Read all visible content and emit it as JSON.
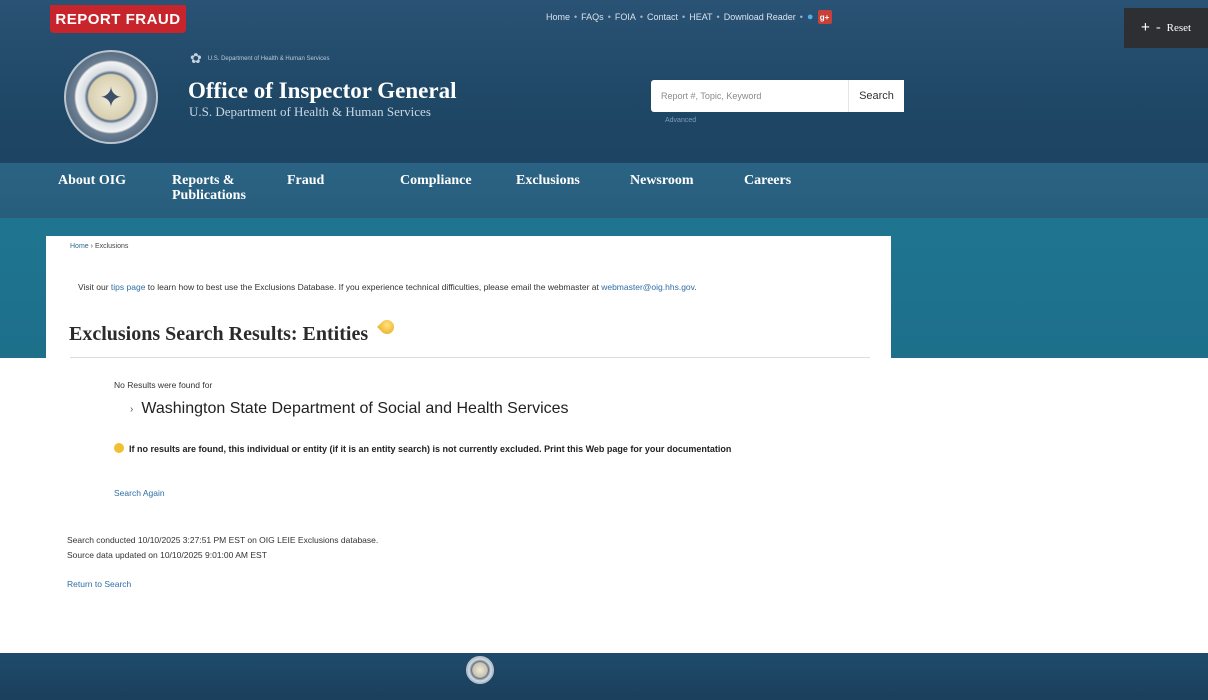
{
  "header": {
    "report_fraud": "REPORT FRAUD",
    "utility_links": [
      "Home",
      "FAQs",
      "FOIA",
      "Contact",
      "HEAT",
      "Download Reader"
    ],
    "separator": "•",
    "dept_line": "U.S. Department of Health & Human Services",
    "title": "Office of Inspector General",
    "subtitle": "U.S. Department of Health & Human Services",
    "search_placeholder": "Report #, Topic, Keyword",
    "search_button": "Search",
    "advanced": "Advanced",
    "reset_label": "Reset",
    "plus": "+",
    "minus": "-"
  },
  "nav": [
    {
      "label": "About OIG"
    },
    {
      "label": "Reports & Publications"
    },
    {
      "label": "Fraud"
    },
    {
      "label": "Compliance"
    },
    {
      "label": "Exclusions"
    },
    {
      "label": "Newsroom"
    },
    {
      "label": "Careers"
    }
  ],
  "breadcrumb": {
    "home": "Home",
    "sep": "›",
    "current": "Exclusions"
  },
  "intro": {
    "pre": "Visit our ",
    "tips_link": "tips page",
    "mid": " to learn how to best use the Exclusions Database. If you experience technical difficulties, please email the webmaster at ",
    "email_link": "webmaster@oig.hhs.gov",
    "post": "."
  },
  "page_title": "Exclusions Search Results: Entities",
  "results": {
    "no_results": "No Results were found for",
    "entity": "Washington State Department of Social and Health Services",
    "notice": "If no results are found, this individual or entity (if it is an entity search) is not currently excluded. Print this Web page for your documentation",
    "search_again": "Search Again",
    "conducted": "Search conducted 10/10/2025 3:27:51 PM EST on OIG LEIE Exclusions database.",
    "updated": "Source data updated on 10/10/2025 9:01:00 AM EST",
    "return": "Return to Search"
  },
  "icons": {
    "arrow": "›",
    "twitter": "twitter-icon",
    "googleplus": "g+"
  },
  "colors": {
    "header_bg": "#1f4766",
    "nav_bg": "#2b6384",
    "teal_band": "#1f7590",
    "report_fraud": "#c8242b",
    "link": "#2f6ea6"
  }
}
